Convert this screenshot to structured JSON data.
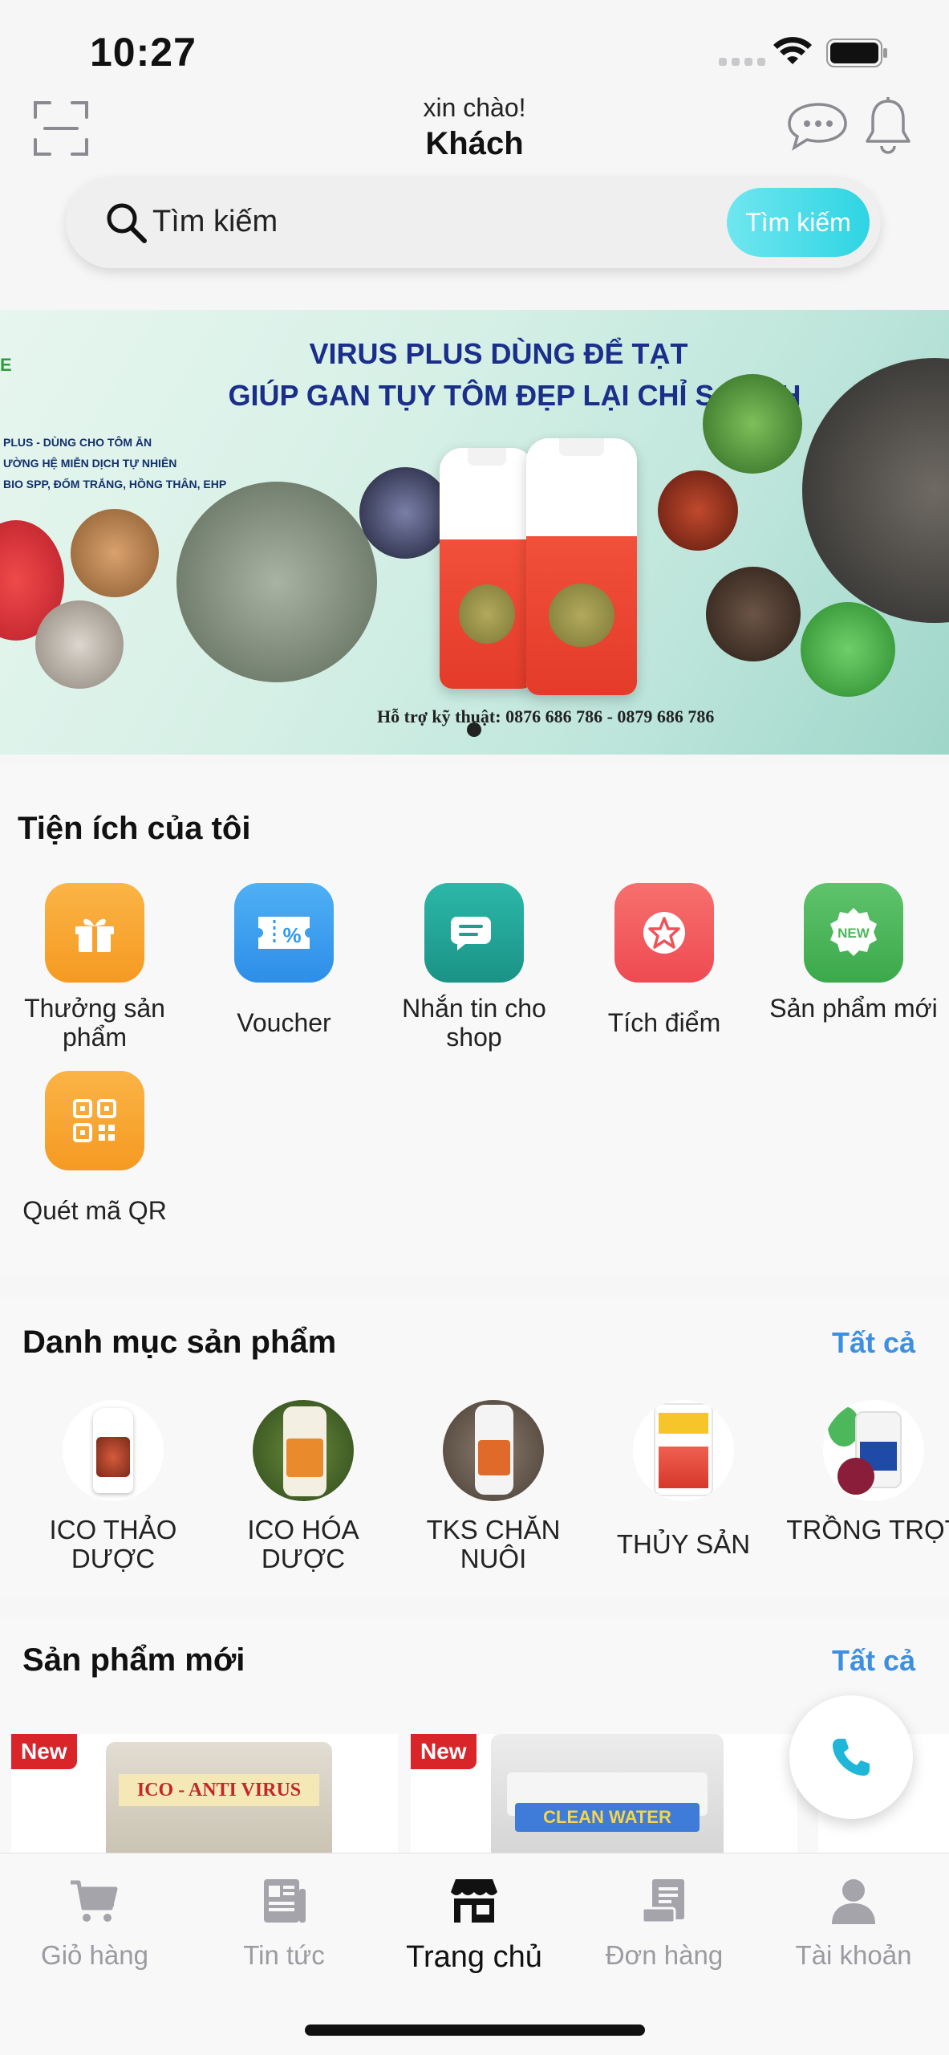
{
  "status_bar": {
    "time": "10:27"
  },
  "header": {
    "greeting": "xin chào!",
    "user_name": "Khách"
  },
  "search": {
    "placeholder": "Tìm kiếm",
    "button_label": "Tìm kiếm"
  },
  "banner": {
    "line1": "VIRUS PLUS DÙNG ĐỂ TẠT",
    "line2": "GIÚP GAN TỤY TÔM ĐẸP LẠI CHỈ SAU 2H",
    "left_text": [
      "PLUS - DÙNG CHO TÔM ĂN",
      "ƯỜNG HỆ MIỄN DỊCH TỰ NHIÊN",
      "BIO SPP, ĐỐM TRẮNG, HỒNG THÂN, EHP"
    ],
    "logo_fragment": "E",
    "support": "Hỗ trợ kỹ thuật: 0876 686 786 - 0879 686 786"
  },
  "utilities": {
    "title": "Tiện ích của tôi",
    "items": [
      {
        "label": "Thưởng sản phẩm",
        "icon": "gift-icon",
        "color": "#f9a12f"
      },
      {
        "label": "Voucher",
        "icon": "voucher-icon",
        "color": "#2f9bf0"
      },
      {
        "label": "Nhắn tin cho shop",
        "icon": "chat-bubble-icon",
        "color": "#21a79b"
      },
      {
        "label": "Tích điểm",
        "icon": "star-icon",
        "color": "#f2565c"
      },
      {
        "label": "Sản phẩm mới",
        "icon": "new-badge-icon",
        "color": "#4cb85b"
      },
      {
        "label": "Quét mã QR",
        "icon": "qr-icon",
        "color": "#f9a12f"
      }
    ]
  },
  "categories": {
    "title": "Danh mục sản phẩm",
    "see_all": "Tất cả",
    "items": [
      {
        "label": "ICO THẢO DƯỢC"
      },
      {
        "label": "ICO HÓA DƯỢC"
      },
      {
        "label": "TKS CHĂN NUÔI"
      },
      {
        "label": "THỦY SẢN"
      },
      {
        "label": "TRỒNG TRỌT"
      }
    ]
  },
  "new_products": {
    "title": "Sản phẩm mới",
    "see_all": "Tất cả",
    "badge": "New",
    "items": [
      {
        "pack_title": "ICO - ANTI VIRUS"
      },
      {
        "pack_title": "CLEAN WATER"
      }
    ]
  },
  "tabs": [
    {
      "label": "Giỏ hàng",
      "icon": "cart-icon",
      "active": false
    },
    {
      "label": "Tin tức",
      "icon": "news-icon",
      "active": false
    },
    {
      "label": "Trang chủ",
      "icon": "store-icon",
      "active": true
    },
    {
      "label": "Đơn hàng",
      "icon": "orders-icon",
      "active": false
    },
    {
      "label": "Tài khoản",
      "icon": "account-icon",
      "active": false
    }
  ],
  "colors": {
    "accent": "#3f8fe0",
    "search_button": "#2ed4e3",
    "new_badge": "#d9242a",
    "call": "#1fb6d9"
  }
}
